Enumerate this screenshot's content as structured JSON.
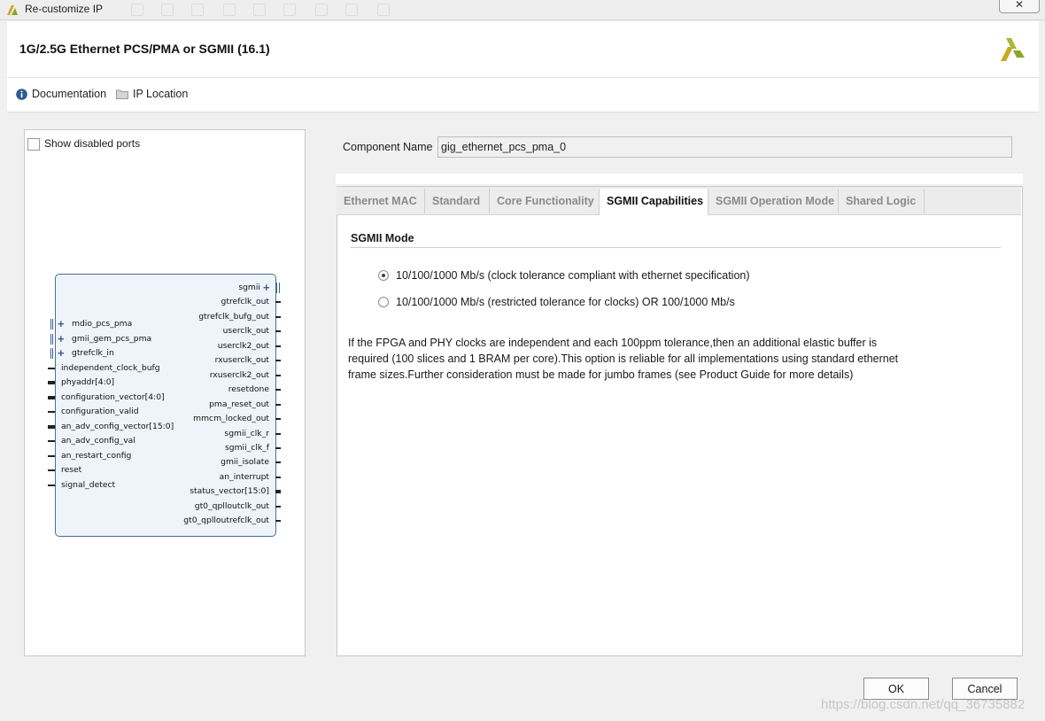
{
  "window": {
    "title": "Re-customize IP",
    "close_label": "✕"
  },
  "header": {
    "title": "1G/2.5G Ethernet PCS/PMA or SGMII (16.1)"
  },
  "toolbar": {
    "items": [
      {
        "label": "Documentation",
        "icon": "info-icon"
      },
      {
        "label": "IP Location",
        "icon": "folder-icon"
      }
    ]
  },
  "left_panel": {
    "show_disabled_ports": {
      "label": "Show disabled ports",
      "checked": false
    },
    "block": {
      "left_ports": [
        {
          "label": "mdio_pcs_pma",
          "kind": "interface"
        },
        {
          "label": "gmii_gem_pcs_pma",
          "kind": "interface"
        },
        {
          "label": "gtrefclk_in",
          "kind": "interface"
        },
        {
          "label": "independent_clock_bufg",
          "kind": "pin"
        },
        {
          "label": "phyaddr[4:0]",
          "kind": "bus"
        },
        {
          "label": "configuration_vector[4:0]",
          "kind": "bus"
        },
        {
          "label": "configuration_valid",
          "kind": "pin"
        },
        {
          "label": "an_adv_config_vector[15:0]",
          "kind": "bus"
        },
        {
          "label": "an_adv_config_val",
          "kind": "pin"
        },
        {
          "label": "an_restart_config",
          "kind": "pin"
        },
        {
          "label": "reset",
          "kind": "pin"
        },
        {
          "label": "signal_detect",
          "kind": "pin"
        }
      ],
      "right_ports": [
        {
          "label": "sgmii",
          "kind": "interface"
        },
        {
          "label": "gtrefclk_out",
          "kind": "pin"
        },
        {
          "label": "gtrefclk_bufg_out",
          "kind": "pin"
        },
        {
          "label": "userclk_out",
          "kind": "pin"
        },
        {
          "label": "userclk2_out",
          "kind": "pin"
        },
        {
          "label": "rxuserclk_out",
          "kind": "pin"
        },
        {
          "label": "rxuserclk2_out",
          "kind": "pin"
        },
        {
          "label": "resetdone",
          "kind": "pin"
        },
        {
          "label": "pma_reset_out",
          "kind": "pin"
        },
        {
          "label": "mmcm_locked_out",
          "kind": "pin"
        },
        {
          "label": "sgmii_clk_r",
          "kind": "pin"
        },
        {
          "label": "sgmii_clk_f",
          "kind": "pin"
        },
        {
          "label": "gmii_isolate",
          "kind": "pin"
        },
        {
          "label": "an_interrupt",
          "kind": "pin"
        },
        {
          "label": "status_vector[15:0]",
          "kind": "bus"
        },
        {
          "label": "gt0_qplloutclk_out",
          "kind": "pin"
        },
        {
          "label": "gt0_qplloutrefclk_out",
          "kind": "pin"
        }
      ]
    }
  },
  "component": {
    "label": "Component Name",
    "value": "gig_ethernet_pcs_pma_0"
  },
  "tabs": [
    {
      "label": "Ethernet MAC",
      "active": false
    },
    {
      "label": "Standard",
      "active": false
    },
    {
      "label": "Core Functionality",
      "active": false
    },
    {
      "label": "SGMII Capabilities",
      "active": true
    },
    {
      "label": "SGMII Operation Mode",
      "active": false
    },
    {
      "label": "Shared Logic",
      "active": false
    }
  ],
  "sgmii": {
    "section_title": "SGMII Mode",
    "options": [
      {
        "label": "10/100/1000 Mb/s (clock tolerance compliant with ethernet specification)",
        "selected": true
      },
      {
        "label": "10/100/1000 Mb/s (restricted tolerance for clocks) OR 100/1000 Mb/s",
        "selected": false
      }
    ],
    "description": [
      "If the FPGA and PHY clocks are independent and each 100ppm tolerance,then an additional elastic buffer is",
      "required (100 slices and 1 BRAM per core).This option is reliable for all implementations using standard ethernet",
      "frame sizes.Further consideration must be made for jumbo frames (see Product Guide for more details)"
    ]
  },
  "buttons": {
    "ok": "OK",
    "cancel": "Cancel"
  },
  "watermark": "https://blog.csdn.net/qq_36735882",
  "colors": {
    "block_fill": "#eef4fa",
    "block_border": "#4f6d92",
    "xilinx_logo": "#8aa624"
  }
}
